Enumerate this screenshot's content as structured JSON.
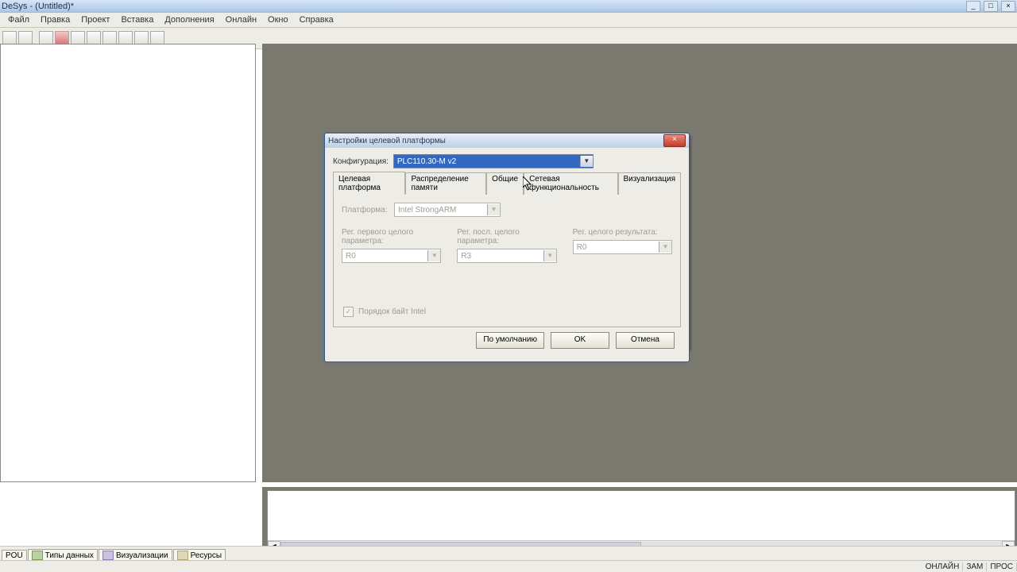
{
  "titlebar": {
    "title": "DeSys - (Untitled)*"
  },
  "menu": {
    "file": "Файл",
    "edit": "Правка",
    "project": "Проект",
    "insert": "Вставка",
    "addons": "Дополнения",
    "online": "Онлайн",
    "window": "Окно",
    "help": "Справка"
  },
  "tabs": {
    "pou": "POU",
    "types": "Типы данных",
    "visual": "Визуализации",
    "resources": "Ресурсы"
  },
  "status": {
    "online": "ОНЛАЙН",
    "zam": "ЗАМ",
    "prog": "ПРОС"
  },
  "dialog": {
    "title": "Настройки целевой платформы",
    "confLabel": "Конфигурация:",
    "confValue": "PLC110.30-M v2",
    "tabs": {
      "t1": "Целевая платформа",
      "t2": "Распределение памяти",
      "t3": "Общие",
      "t4": "Сетевая функциональность",
      "t5": "Визуализация"
    },
    "platformLabel": "Платформа:",
    "platformValue": "Intel StrongARM",
    "reg1Label": "Рег. первого целого параметра:",
    "reg1Value": "R0",
    "reg2Label": "Рег. посл. целого параметра:",
    "reg2Value": "R3",
    "reg3Label": "Рег. целого результата:",
    "reg3Value": "R0",
    "intelCheck": "Порядок байт Intel",
    "btnDefault": "По умолчанию",
    "btnOk": "OK",
    "btnCancel": "Отмена"
  }
}
